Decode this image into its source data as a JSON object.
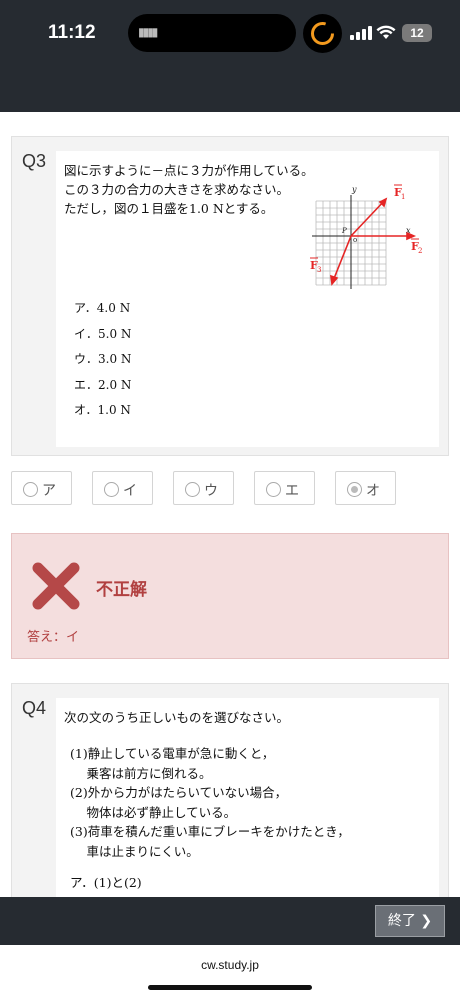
{
  "status": {
    "time": "11:12",
    "battery": "12"
  },
  "q3": {
    "number": "Q3",
    "text": "図に示すように－点に３力が作用している。\nこの３力の合力の大きさを求めなさい。\nただし，図の１目盛を1.0 Nとする。",
    "figure": {
      "y": "y",
      "x": "x",
      "p": "P",
      "o": "o",
      "f1": "F",
      "f1sub": "1",
      "f2": "F",
      "f2sub": "2",
      "f3": "F",
      "f3sub": "3"
    },
    "choices": [
      "ア．4.0 N",
      "イ．5.0 N",
      "ウ．3.0 N",
      "エ．2.0 N",
      "オ．1.0 N"
    ]
  },
  "answer_options": [
    {
      "label": "ア",
      "selected": false
    },
    {
      "label": "イ",
      "selected": false
    },
    {
      "label": "ウ",
      "selected": false
    },
    {
      "label": "エ",
      "selected": false
    },
    {
      "label": "オ",
      "selected": true
    }
  ],
  "result": {
    "title": "不正解",
    "answer": "答え：イ",
    "color": "#b14040"
  },
  "q4": {
    "number": "Q4",
    "text": "次の文のうち正しいものを選びなさい。",
    "items": [
      "(1)静止している電車が急に動くと，",
      "　  乗客は前方に倒れる。",
      "(2)外から力がはたらいていない場合，",
      "　  物体は必ず静止している。",
      "(3)荷車を積んだ重い車にブレーキをかけたとき，",
      "　  車は止まりにくい。"
    ],
    "choice_a": "ア．(1)と(2)"
  },
  "footer": {
    "end_label": "終了 ❯",
    "url": "cw.study.jp"
  }
}
